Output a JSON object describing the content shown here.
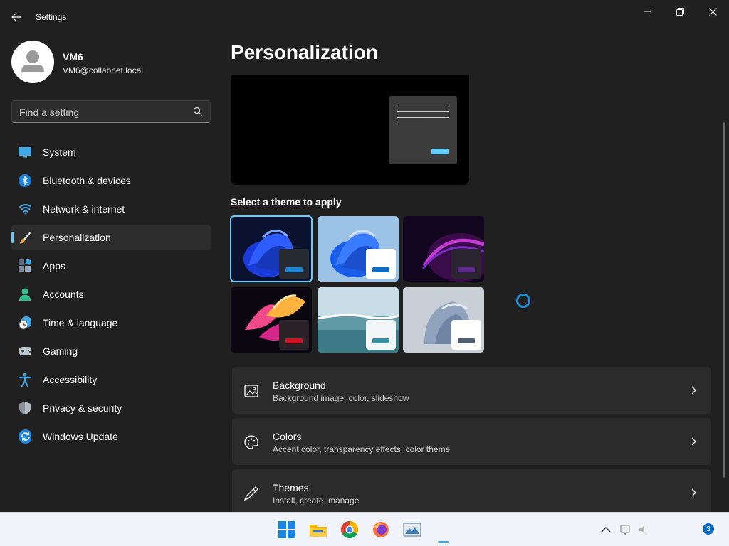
{
  "window": {
    "title": "Settings"
  },
  "profile": {
    "name": "VM6",
    "email": "VM6@collabnet.local"
  },
  "search": {
    "placeholder": "Find a setting"
  },
  "sidebar": {
    "items": [
      {
        "label": "System",
        "icon": "system-icon"
      },
      {
        "label": "Bluetooth & devices",
        "icon": "bluetooth-icon"
      },
      {
        "label": "Network & internet",
        "icon": "wifi-icon"
      },
      {
        "label": "Personalization",
        "icon": "brush-icon",
        "active": true
      },
      {
        "label": "Apps",
        "icon": "apps-icon"
      },
      {
        "label": "Accounts",
        "icon": "accounts-icon"
      },
      {
        "label": "Time & language",
        "icon": "clock-globe-icon"
      },
      {
        "label": "Gaming",
        "icon": "gamepad-icon"
      },
      {
        "label": "Accessibility",
        "icon": "accessibility-icon"
      },
      {
        "label": "Privacy & security",
        "icon": "shield-icon"
      },
      {
        "label": "Windows Update",
        "icon": "update-icon"
      }
    ]
  },
  "main": {
    "title": "Personalization",
    "themes_label": "Select a theme to apply",
    "themes": [
      {
        "name": "windows-dark-bloom",
        "selected": true
      },
      {
        "name": "windows-light-bloom"
      },
      {
        "name": "glow"
      },
      {
        "name": "captured-motion"
      },
      {
        "name": "sunrise"
      },
      {
        "name": "flow"
      }
    ],
    "cards": [
      {
        "title": "Background",
        "subtitle": "Background image, color, slideshow",
        "icon": "image-icon"
      },
      {
        "title": "Colors",
        "subtitle": "Accent color, transparency effects, color theme",
        "icon": "palette-icon"
      },
      {
        "title": "Themes",
        "subtitle": "Install, create, manage",
        "icon": "pen-icon"
      }
    ]
  },
  "taskbar": {
    "apps": [
      "start-icon",
      "file-explorer-icon",
      "chrome-icon",
      "firefox-icon",
      "photos-icon"
    ],
    "notification_count": "3"
  },
  "colors": {
    "accent": "#60cdff",
    "background": "#202020",
    "card": "#2b2b2b"
  }
}
